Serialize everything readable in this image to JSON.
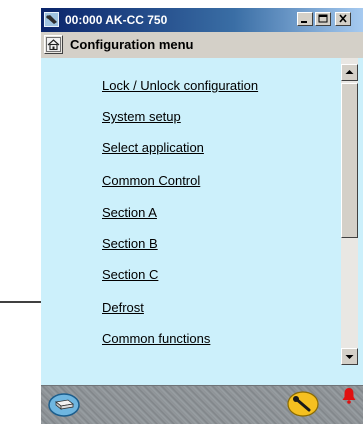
{
  "window": {
    "title": "00:000 AK-CC 750"
  },
  "header": {
    "title": "Configuration menu"
  },
  "menu": {
    "items": [
      {
        "label": "Lock / Unlock configuration"
      },
      {
        "label": "System setup"
      },
      {
        "label": "Select application"
      },
      {
        "label": "Common Control"
      },
      {
        "label": "Section A"
      },
      {
        "label": "Section B"
      },
      {
        "label": "Section C"
      },
      {
        "label": "Defrost"
      },
      {
        "label": "Common functions"
      }
    ]
  },
  "icons": {
    "app": "app-icon",
    "home": "home-icon",
    "status_left": "disk-icon",
    "status_mid": "key-icon",
    "status_right": "alarm-bell-icon",
    "pointer": "arrow-pointer"
  },
  "colors": {
    "title_bar": "#0a246a",
    "content_bg": "#ccf0fb",
    "alarm": "#e01010",
    "key_badge": "#f5c020"
  }
}
